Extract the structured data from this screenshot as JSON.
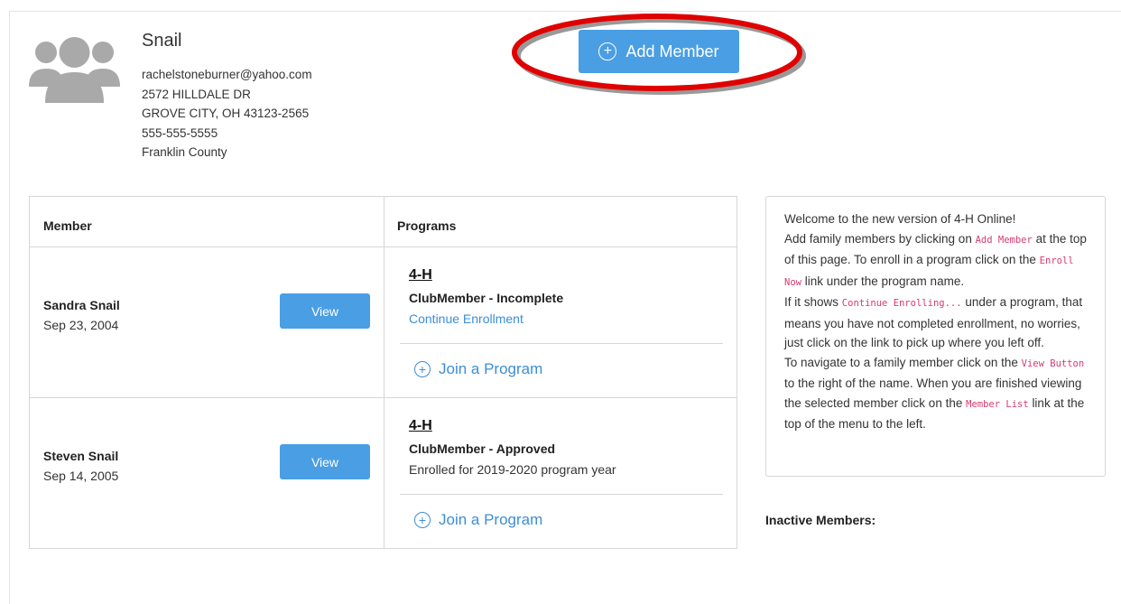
{
  "family": {
    "name": "Snail",
    "email": "rachelstoneburner@yahoo.com",
    "address": "2572 HILLDALE DR",
    "city_state_zip": "GROVE CITY, OH 43123-2565",
    "phone": "555-555-5555",
    "county": "Franklin County"
  },
  "add_member": {
    "label": "Add Member"
  },
  "table": {
    "header_member": "Member",
    "header_programs": "Programs"
  },
  "members": [
    {
      "name": "Sandra Snail",
      "dob": "Sep 23, 2004",
      "view_label": "View",
      "program": "4-H",
      "status": "ClubMember - Incomplete",
      "link": "Continue Enrollment",
      "join_label": "Join a Program"
    },
    {
      "name": "Steven Snail",
      "dob": "Sep 14, 2005",
      "view_label": "View",
      "program": "4-H",
      "status": "ClubMember - Approved",
      "note": "Enrolled for 2019-2020 program year",
      "join_label": "Join a Program"
    }
  ],
  "info": {
    "l1": "Welcome to the new version of 4-H Online!",
    "l2a": "Add family members by clicking on",
    "l2code": "Add Member",
    "l2b": "at the top of this page. To enroll in a program click on the",
    "l3code": "Enroll Now",
    "l3b": "link under the program name.",
    "l4a": "If it shows",
    "l4code": "Continue Enrolling...",
    "l4b": "under a program, that means you have not completed enrollment, no worries, just click on the link to pick up where you left off.",
    "l5a": "To navigate to a family member click on the",
    "l5code": "View Button",
    "l5b": "to the right of the name. When you are finished viewing the selected member click on the",
    "l6code": "Member List",
    "l6b": "link at the top of the menu to the left."
  },
  "inactive": {
    "title": "Inactive Members:"
  },
  "colors": {
    "primary": "#4a9ee3",
    "link": "#3b8ed8",
    "code": "#d63a6f",
    "annotation": "#e00000"
  },
  "icons": [
    "family-avatar-icon",
    "plus-circle-icon"
  ]
}
